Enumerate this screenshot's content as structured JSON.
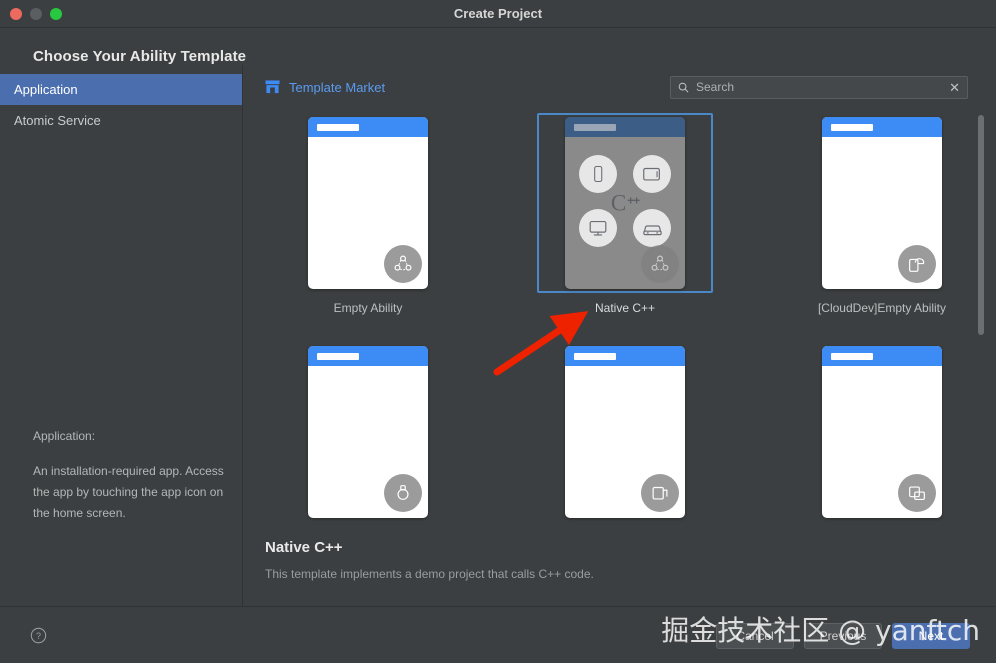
{
  "window": {
    "title": "Create Project",
    "traffic_lights": [
      "close-button",
      "minimize-button",
      "zoom-button"
    ]
  },
  "heading": "Choose Your Ability Template",
  "sidebar": {
    "items": [
      {
        "label": "Application",
        "selected": true
      },
      {
        "label": "Atomic Service",
        "selected": false
      }
    ],
    "description_label": "Application:",
    "description_text": "An installation-required app. Access the app by touching the app icon on the home screen."
  },
  "toolbar": {
    "market_link": "Template Market",
    "market_icon": "store-icon",
    "search": {
      "placeholder": "Search",
      "value": "",
      "icon": "search-icon",
      "clear_icon": "clear-icon"
    }
  },
  "templates": [
    {
      "label": "Empty Ability",
      "badge_icon": "ability-network-icon",
      "selected": false,
      "style": "light"
    },
    {
      "label": "Native C++",
      "badge_icon": "ability-network-icon",
      "selected": true,
      "style": "devices",
      "devices": [
        "phone-icon",
        "tablet-icon",
        "tv-icon",
        "car-icon"
      ],
      "center_text": "C++"
    },
    {
      "label": "[CloudDev]Empty Ability",
      "badge_icon": "cloud-ability-icon",
      "selected": false,
      "style": "light"
    },
    {
      "label": "",
      "badge_icon": "watch-icon",
      "selected": false,
      "style": "light"
    },
    {
      "label": "",
      "badge_icon": "blank-icon",
      "selected": false,
      "style": "light"
    },
    {
      "label": "",
      "badge_icon": "multi-window-icon",
      "selected": false,
      "style": "light"
    }
  ],
  "detail": {
    "title": "Native C++",
    "description": "This template implements a demo project that calls C++ code."
  },
  "footer": {
    "help_icon": "help-icon",
    "cancel_label": "Cancel",
    "previous_label": "Previous",
    "next_label": "Next"
  },
  "annotations": {
    "watermark": "掘金技术社区 @ yanftch",
    "arrow": "red-arrow-pointing-to-native-cpp"
  },
  "colors": {
    "accent_blue": "#4b6eaf",
    "link_blue": "#5a9bf0",
    "thumb_bar_blue": "#3d8bf5",
    "selection_border": "#4a88c7",
    "window_bg": "#3c3f41",
    "arrow_red": "#ef2200"
  }
}
